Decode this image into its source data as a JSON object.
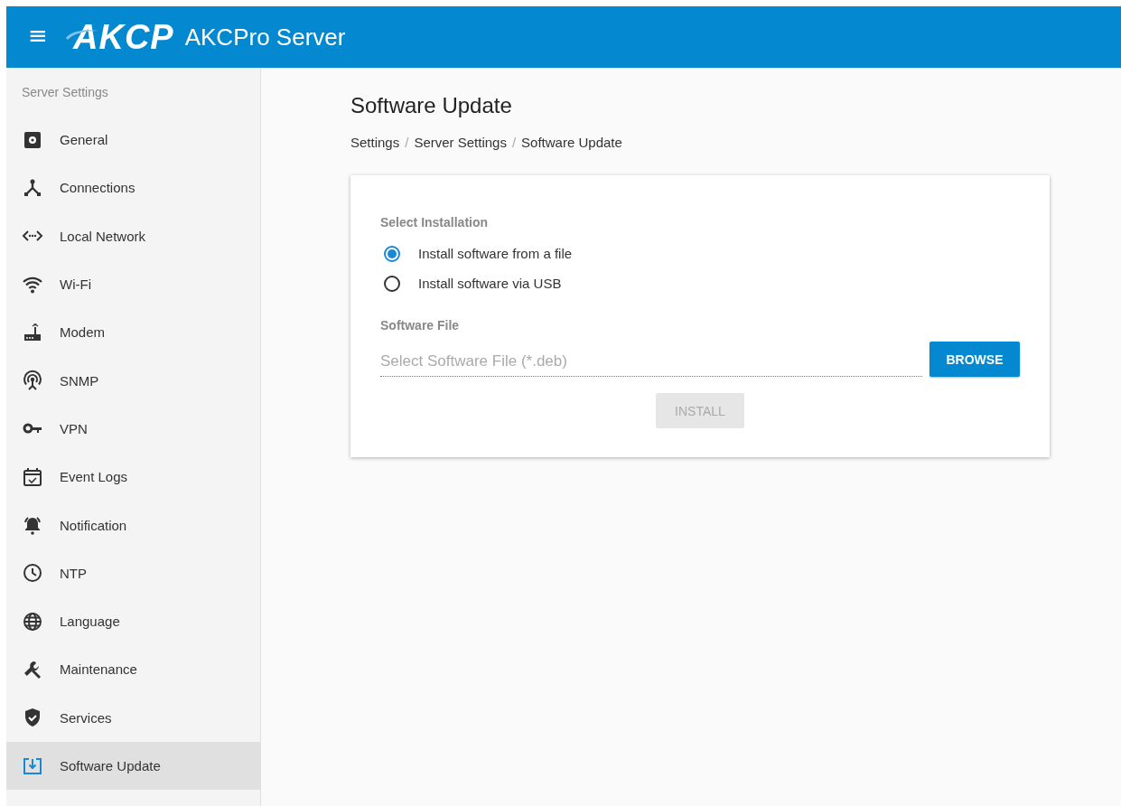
{
  "header": {
    "menu_icon": "≡",
    "logo": "AKCP",
    "title": "AKCPro Server"
  },
  "sidebar": {
    "heading": "Server Settings",
    "items": [
      {
        "label": "General",
        "selected": false
      },
      {
        "label": "Connections",
        "selected": false
      },
      {
        "label": "Local Network",
        "selected": false
      },
      {
        "label": "Wi-Fi",
        "selected": false
      },
      {
        "label": "Modem",
        "selected": false
      },
      {
        "label": "SNMP",
        "selected": false
      },
      {
        "label": "VPN",
        "selected": false
      },
      {
        "label": "Event Logs",
        "selected": false
      },
      {
        "label": "Notification",
        "selected": false
      },
      {
        "label": "NTP",
        "selected": false
      },
      {
        "label": "Language",
        "selected": false
      },
      {
        "label": "Maintenance",
        "selected": false
      },
      {
        "label": "Services",
        "selected": false
      },
      {
        "label": "Software Update",
        "selected": true
      }
    ]
  },
  "page": {
    "title": "Software Update",
    "breadcrumb": [
      {
        "label": "Settings",
        "separator": "/"
      },
      {
        "label": "Server Settings",
        "separator": "/"
      },
      {
        "label": "Software Update"
      }
    ],
    "installation": {
      "label": "Select Installation",
      "options": [
        {
          "label": "Install software from a file",
          "selected": true
        },
        {
          "label": "Install software via USB",
          "selected": false
        }
      ]
    },
    "file": {
      "label": "Software File",
      "placeholder": "Select Software File (*.deb)",
      "browse": "BROWSE"
    },
    "install": {
      "label": "INSTALL",
      "disabled": true
    }
  }
}
